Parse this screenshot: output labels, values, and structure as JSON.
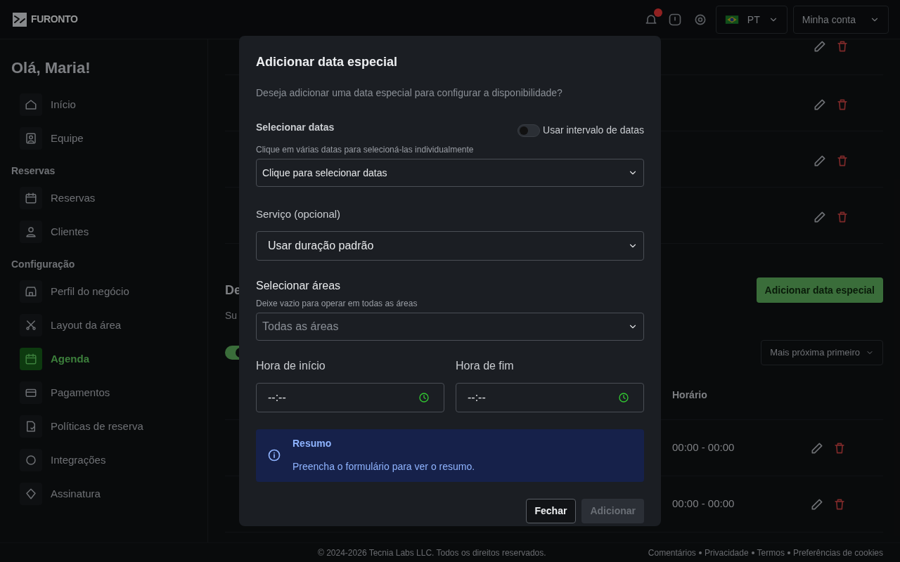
{
  "header": {
    "logo": "FURONTO",
    "notifications": {
      "unread": true
    },
    "language": "PT",
    "account": "Minha conta"
  },
  "sidebar": {
    "greeting": "Olá, Maria!",
    "sections": [
      {
        "items": [
          {
            "label": "Início",
            "selected": false
          },
          {
            "label": "Equipe",
            "selected": false
          }
        ]
      },
      {
        "title": "Reservas",
        "items": [
          {
            "label": "Reservas",
            "selected": false
          },
          {
            "label": "Clientes",
            "selected": false
          }
        ]
      },
      {
        "title": "Configuração",
        "items": [
          {
            "label": "Perfil do negócio",
            "selected": false
          },
          {
            "label": "Layout da área",
            "selected": false
          },
          {
            "label": "Agenda",
            "selected": true
          },
          {
            "label": "Pagamentos",
            "selected": false
          },
          {
            "label": "Políticas de reserva",
            "selected": false
          },
          {
            "label": "Integrações",
            "selected": false
          },
          {
            "label": "Assinatura",
            "selected": false
          }
        ]
      }
    ]
  },
  "main": {
    "section_heading": "De",
    "section_subtitle": "Su",
    "add_button": "Adicionar data especial",
    "toggle": {
      "on": true
    },
    "sort": "Mais próxima primeiro",
    "table": {
      "columns": [
        "Horário"
      ],
      "rows": [
        {
          "time": "00:00 - 00:00"
        },
        {
          "time": "00:00 - 00:00"
        }
      ]
    }
  },
  "footer": {
    "copyright": "© 2024-2026 Tecnia Labs LLC. Todos os direitos reservados.",
    "links": [
      "Comentários",
      "Privacidade",
      "Termos",
      "Preferências de cookies"
    ]
  },
  "dialog": {
    "title": "Adicionar data especial",
    "description": "Deseja adicionar uma data especial para configurar a disponibilidade?",
    "dates": {
      "label": "Selecionar datas",
      "range_toggle": {
        "label": "Usar intervalo de datas",
        "on": false
      },
      "hint": "Clique em várias datas para selecioná-las individualmente",
      "placeholder": "Clique para selecionar datas"
    },
    "service": {
      "label": "Serviço (opcional)",
      "value": "Usar duração padrão"
    },
    "areas": {
      "label": "Selecionar áreas",
      "hint": "Deixe vazio para operar em todas as áreas",
      "placeholder": "Todas as áreas"
    },
    "start": {
      "label": "Hora de início",
      "value": "--:--"
    },
    "end": {
      "label": "Hora de fim",
      "value": "--:--"
    },
    "summary": {
      "title": "Resumo",
      "text": "Preencha o formulário para ver o resumo."
    },
    "buttons": [
      {
        "label": "Fechar",
        "disabled": false
      },
      {
        "label": "Adicionar",
        "disabled": true
      }
    ]
  }
}
